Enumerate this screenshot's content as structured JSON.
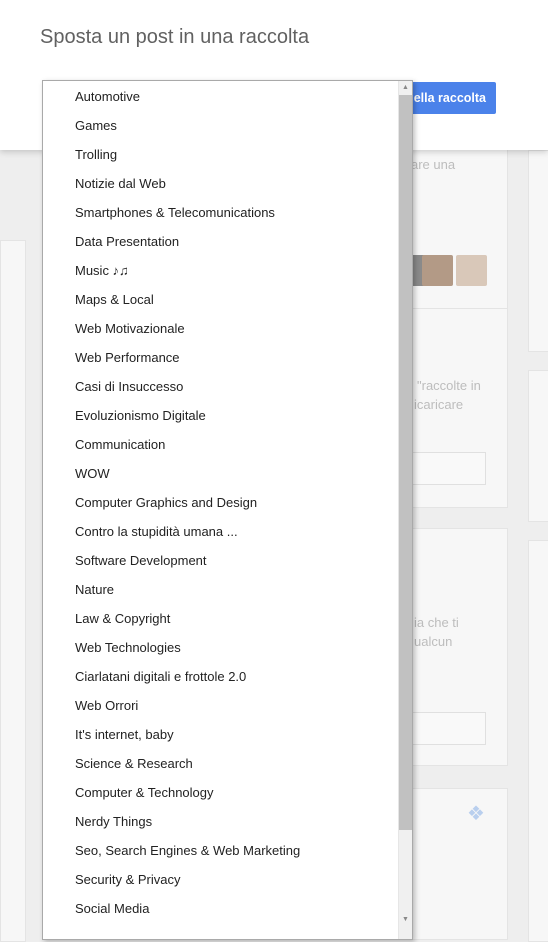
{
  "dialog": {
    "title": "Sposta un post in una raccolta",
    "confirm_button": "nella raccolta"
  },
  "background": {
    "text_1": "are una",
    "text_2": "\"raccolte in",
    "text_3": "icaricare",
    "text_4": "ia che ti",
    "text_5": "ualcun"
  },
  "dropdown": {
    "items": [
      "Automotive",
      "Games",
      "Trolling",
      "Notizie dal Web",
      "Smartphones & Telecomunications",
      "Data Presentation",
      "Music ♪♫",
      "Maps & Local",
      "Web Motivazionale",
      "Web Performance",
      "Casi di Insuccesso",
      "Evoluzionismo Digitale",
      "Communication",
      "WOW",
      "Computer Graphics and Design",
      "Contro la stupidità umana ...",
      "Software Development",
      "Nature",
      "Law & Copyright",
      "Web Technologies",
      "Ciarlatani digitali e frottole 2.0",
      "Web Orrori",
      "It's internet, baby",
      "Science & Research",
      "Computer & Technology",
      "Nerdy Things",
      "Seo, Search Engines & Web Marketing",
      "Security & Privacy",
      "Social Media"
    ]
  },
  "colors": {
    "primary_button": "#4b82ea",
    "scroll_thumb": "#c1c1c1"
  }
}
